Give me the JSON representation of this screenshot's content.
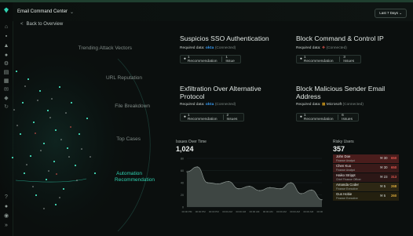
{
  "app": {
    "title": "Email Command Center",
    "time_range": "Last 7 Days"
  },
  "nav": {
    "back_label": "Back to Overview"
  },
  "menu": [
    {
      "label": "Trending Attack Vectors"
    },
    {
      "label": "URL Reputation"
    },
    {
      "label": "File Breakdown"
    },
    {
      "label": "Top Cases"
    },
    {
      "label": "Automation"
    },
    {
      "label": "Recommendation"
    }
  ],
  "cards": [
    {
      "title": "Suspicios SSO Authentication",
      "title2": "",
      "required_label": "Required data:",
      "vendor": "okta",
      "status": "(Connected)",
      "recommendations": "1 Recommendation",
      "issues": "1 Issue"
    },
    {
      "title": "Block Command & Control IP",
      "title2": "",
      "required_label": "Required data:",
      "vendor": "",
      "status": "(Connected)",
      "recommendations": "1 Recommendation",
      "issues": "3 Issues"
    },
    {
      "title": "Exfiltration Over Alternative",
      "title2": "Protocol",
      "required_label": "Required data:",
      "vendor": "okta",
      "status": "(Connected)",
      "recommendations": "1 Recommendation",
      "issues": "2 Issues"
    },
    {
      "title": "Block Malicious Sender Email",
      "title2": "Address",
      "required_label": "Required data:",
      "vendor": "Microsoft",
      "status": "(Connected)",
      "recommendations": "1 Recommendation",
      "issues": "6 Issues"
    }
  ],
  "issues_over_time": {
    "label": "Issues Over Time",
    "value": "1,024"
  },
  "chart_data": {
    "type": "area",
    "x": [
      "00:00 PM",
      "00:00 PM",
      "00:00 PM",
      "00:00 AM",
      "00:00 AM",
      "00:00 AM",
      "00:00 AM",
      "00:00 AM",
      "00:00 AM",
      "00:00 AM",
      "00:00 PM"
    ],
    "y_ticks": [
      "80",
      "60",
      "40",
      "20",
      "0"
    ],
    "series": [
      {
        "values": [
          58,
          66,
          40,
          38,
          42,
          30,
          34,
          27,
          32,
          30,
          40,
          22,
          28,
          12
        ]
      }
    ],
    "ylim": [
      0,
      80
    ],
    "color": "#8e9894"
  },
  "risky_users": {
    "label": "Risky Users",
    "value": "357",
    "rows": [
      {
        "name": "John Doe",
        "role": "Finance Analyst",
        "count": "30",
        "score": "650",
        "color": "#e0564f",
        "bg": "#4a1d1c"
      },
      {
        "name": "Chen Kuo",
        "role": "Finance Analyst",
        "count": "30",
        "score": "650",
        "color": "#e0564f",
        "bg": "#3a1a19"
      },
      {
        "name": "Haiko Strippt",
        "role": "Chief Finance Officer",
        "count": "23",
        "score": "313",
        "color": "#e0564f",
        "bg": "#2c1716"
      },
      {
        "name": "Amanda Coder",
        "role": "Finance Executive",
        "count": "5",
        "score": "268",
        "color": "#d9a93a",
        "bg": "#2d2714"
      },
      {
        "name": "Gus Hobie",
        "role": "Finance Executive",
        "count": "5",
        "score": "260",
        "color": "#d9a93a",
        "bg": "#24200f"
      }
    ]
  }
}
